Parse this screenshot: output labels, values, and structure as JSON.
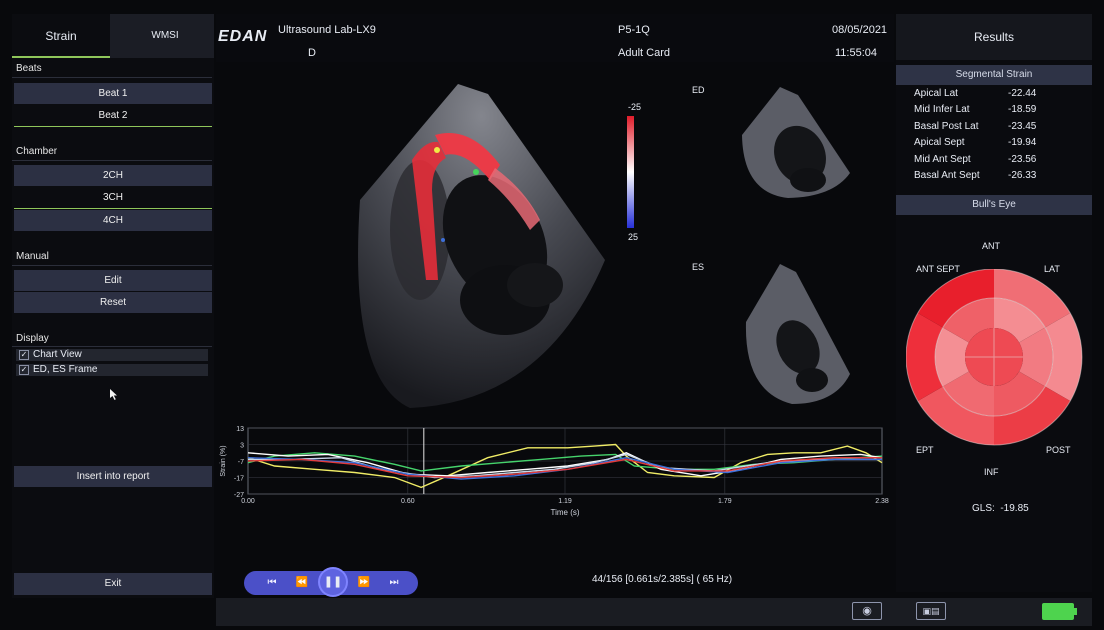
{
  "tabs": [
    "Strain",
    "WMSI"
  ],
  "left": {
    "beats_label": "Beats",
    "beats": [
      "Beat 1",
      "Beat 2"
    ],
    "chamber_label": "Chamber",
    "chambers": [
      "2CH",
      "3CH",
      "4CH"
    ],
    "manual_label": "Manual",
    "manual": [
      "Edit",
      "Reset"
    ],
    "display_label": "Display",
    "display": [
      "Chart View",
      "ED, ES Frame"
    ],
    "insert": "Insert into report",
    "exit": "Exit"
  },
  "header": {
    "brand": "EDAN",
    "lab": "Ultrasound Lab-LX9",
    "mode": "D",
    "probe": "P5-1Q",
    "preset": "Adult Card",
    "date": "08/05/2021",
    "time": "11:55:04"
  },
  "scale": {
    "top": "-25",
    "bottom": "25"
  },
  "frames": {
    "ed": "ED",
    "es": "ES"
  },
  "results": {
    "title": "Results",
    "segmental_title": "Segmental Strain",
    "segments": [
      {
        "name": "Apical Lat",
        "value": "-22.44"
      },
      {
        "name": "Mid Infer Lat",
        "value": "-18.59"
      },
      {
        "name": "Basal Post Lat",
        "value": "-23.45"
      },
      {
        "name": "Apical Sept",
        "value": "-19.94"
      },
      {
        "name": "Mid Ant Sept",
        "value": "-23.56"
      },
      {
        "name": "Basal Ant Sept",
        "value": "-26.33"
      }
    ],
    "bulls_title": "Bull's Eye",
    "bulls_labels": {
      "ant": "ANT",
      "antsept": "ANT SEPT",
      "lat": "LAT",
      "ept": "EPT",
      "post": "POST",
      "inf": "INF"
    },
    "gls": "GLS:  -19.85"
  },
  "status": "44/156 [0.661s/2.385s] ( 65 Hz)",
  "colors": {
    "accent": "#8fc65a",
    "button": "#2c3043",
    "strain_red": "#f03844",
    "battery": "#4ed34e"
  },
  "chart_data": {
    "type": "line",
    "ylabel": "Strain (%)",
    "xlabel": "Time (s)",
    "yticks": [
      "13",
      "3",
      "-7",
      "-17",
      "-27"
    ],
    "xticks": [
      "0.00",
      "0.60",
      "1.19",
      "1.79",
      "2.38"
    ],
    "ylim": [
      -27,
      13
    ],
    "xlim": [
      0,
      2.38
    ],
    "cursor_x": 0.66,
    "series": [
      {
        "color": "#f0ec66",
        "x": [
          0,
          0.1,
          0.25,
          0.4,
          0.55,
          0.65,
          0.75,
          0.9,
          1.05,
          1.2,
          1.3,
          1.38,
          1.42,
          1.5,
          1.6,
          1.75,
          1.85,
          1.95,
          2.05,
          2.15,
          2.25,
          2.32,
          2.38
        ],
        "y": [
          -5,
          -10,
          -12,
          -14,
          -17,
          -23,
          -16,
          -5,
          1,
          1,
          2,
          3,
          -4,
          -14,
          -16,
          -17,
          -8,
          -3,
          -2,
          -2,
          2,
          -2,
          -8
        ]
      },
      {
        "color": "#46d46c",
        "x": [
          0,
          0.1,
          0.25,
          0.4,
          0.55,
          0.65,
          0.8,
          0.95,
          1.1,
          1.25,
          1.38,
          1.45,
          1.6,
          1.75,
          1.9,
          2.05,
          2.2,
          2.38
        ],
        "y": [
          -8,
          -4,
          -2,
          -4,
          -9,
          -13,
          -10,
          -8,
          -6,
          -4,
          -3,
          -10,
          -12,
          -12,
          -9,
          -8,
          -6,
          -4
        ]
      },
      {
        "color": "#ffffff",
        "x": [
          0,
          0.15,
          0.3,
          0.45,
          0.6,
          0.75,
          0.9,
          1.05,
          1.2,
          1.35,
          1.42,
          1.55,
          1.7,
          1.85,
          2.0,
          2.15,
          2.3,
          2.38
        ],
        "y": [
          -2,
          -4,
          -3,
          -8,
          -15,
          -16,
          -14,
          -12,
          -10,
          -6,
          -2,
          -12,
          -16,
          -12,
          -6,
          -4,
          -3,
          -5
        ]
      },
      {
        "color": "#c9d7ea",
        "x": [
          0,
          0.15,
          0.35,
          0.5,
          0.7,
          0.85,
          1.0,
          1.15,
          1.3,
          1.42,
          1.55,
          1.75,
          1.95,
          2.15,
          2.38
        ],
        "y": [
          -6,
          -6,
          -5,
          -12,
          -17,
          -16,
          -14,
          -12,
          -8,
          -3,
          -11,
          -13,
          -8,
          -6,
          -6
        ]
      },
      {
        "color": "#3d6fd9",
        "x": [
          0,
          0.2,
          0.4,
          0.6,
          0.8,
          1.0,
          1.2,
          1.42,
          1.6,
          1.8,
          2.0,
          2.2,
          2.38
        ],
        "y": [
          -5,
          -6,
          -8,
          -15,
          -18,
          -16,
          -12,
          -5,
          -12,
          -14,
          -8,
          -6,
          -6
        ]
      },
      {
        "color": "#e23b3b",
        "x": [
          0,
          0.2,
          0.4,
          0.6,
          0.8,
          1.0,
          1.2,
          1.42,
          1.6,
          1.8,
          2.0,
          2.2,
          2.38
        ],
        "y": [
          -7,
          -6,
          -9,
          -16,
          -17,
          -15,
          -12,
          -6,
          -13,
          -13,
          -7,
          -5,
          -5
        ]
      }
    ]
  }
}
